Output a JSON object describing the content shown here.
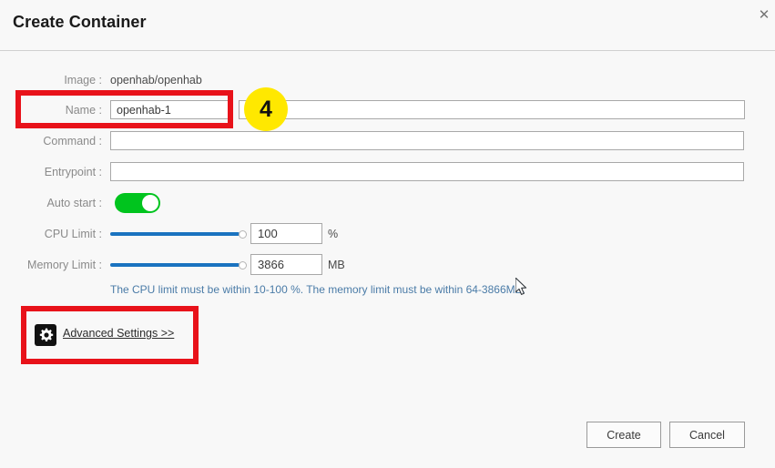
{
  "dialog": {
    "title": "Create Container",
    "close_icon": "close-icon"
  },
  "form": {
    "image": {
      "label": "Image :",
      "value": "openhab/openhab"
    },
    "name": {
      "label": "Name :",
      "value": "openhab-1",
      "placeholder": ""
    },
    "command": {
      "label": "Command :",
      "value": "",
      "placeholder": ""
    },
    "entrypoint": {
      "label": "Entrypoint :",
      "value": "",
      "placeholder": ""
    },
    "auto_start": {
      "label": "Auto start :",
      "state": "on",
      "color": "#00c41e"
    },
    "cpu_limit": {
      "label": "CPU Limit :",
      "value": "100",
      "unit": "%",
      "slider_percent": 100,
      "slider_color": "#1a73c0"
    },
    "memory_limit": {
      "label": "Memory Limit :",
      "value": "3866",
      "unit": "MB",
      "slider_percent": 100,
      "slider_color": "#1a73c0"
    },
    "hint": "The CPU limit must be within 10-100 %. The memory limit must be within 64-3866MB.",
    "hint_color": "#4a7ba7"
  },
  "advanced_settings": {
    "icon": "gear-icon",
    "label": "Advanced Settings >>"
  },
  "footer": {
    "create_label": "Create",
    "cancel_label": "Cancel"
  },
  "annotations": {
    "color": "#e8121a",
    "step_badge": {
      "number": "4",
      "background": "#ffe800"
    }
  }
}
